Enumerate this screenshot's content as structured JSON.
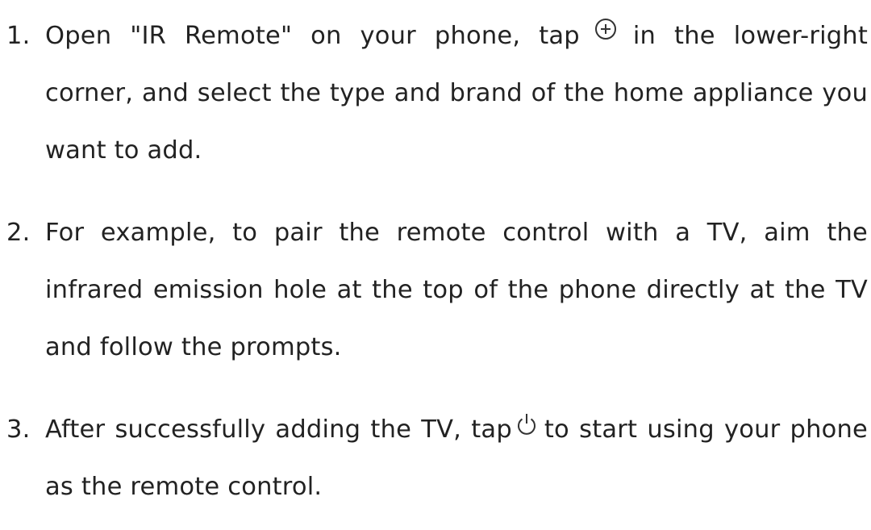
{
  "steps": [
    {
      "number": "1.",
      "text_before_icon": "Open \"IR Remote\" on your phone, tap",
      "icon": "add-circle-icon",
      "text_after_icon": "in the lower-right corner, and select the type and brand of the home appliance you want to add."
    },
    {
      "number": "2.",
      "text": "For example, to pair the remote control with a TV, aim the infrared emission hole at the top of the phone directly at the TV and follow the prompts."
    },
    {
      "number": "3.",
      "text_before_icon": "After successfully adding the TV, tap",
      "icon": "power-icon",
      "text_after_icon": "to start using your phone as the remote control."
    }
  ],
  "colors": {
    "text": "#222222",
    "icon": "#333333"
  }
}
